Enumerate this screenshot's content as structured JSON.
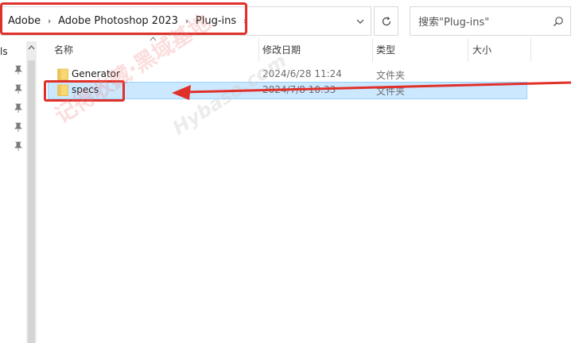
{
  "address_bar": {
    "crumbs": [
      "Adobe",
      "Adobe Photoshop 2023",
      "Plug-ins"
    ]
  },
  "search": {
    "placeholder": "搜索\"Plug-ins\""
  },
  "nav": {
    "partial_label": "ls"
  },
  "columns": {
    "name": "名称",
    "date": "修改日期",
    "type": "类型",
    "size": "大小"
  },
  "files": [
    {
      "name": "Generator",
      "date": "2024/6/28 11:24",
      "type": "文件夹",
      "selected": false,
      "icon": "folder-icon"
    },
    {
      "name": "specs",
      "date": "2024/7/8 10:33",
      "type": "文件夹",
      "selected": true,
      "icon": "folder-icon"
    }
  ],
  "watermark": {
    "text": "记得收藏·黑域基地",
    "latin": "Hybase.com"
  },
  "colors": {
    "annotation": "#e0302a",
    "selection": "#cce8ff",
    "folder": "#f8d775"
  }
}
